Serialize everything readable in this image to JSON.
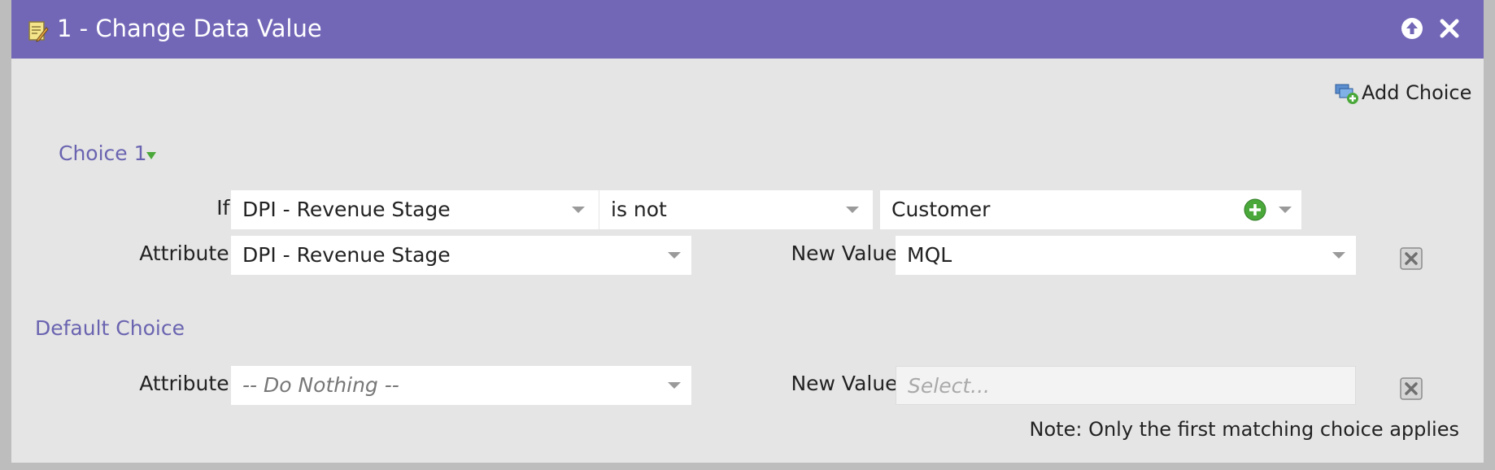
{
  "header": {
    "title": "1 - Change Data Value",
    "icons": [
      "edit-document-icon",
      "collapse-up-icon",
      "close-icon"
    ],
    "color": "#7267b7"
  },
  "toolbar": {
    "add_choice_label": "Add Choice",
    "add_choice_icon": "add-choice-icon"
  },
  "choice1": {
    "title": "Choice 1",
    "if_label": "If:",
    "condition_field": "DPI - Revenue Stage",
    "operator": "is not",
    "condition_value": "Customer",
    "attribute_label": "Attribute:",
    "attribute_value": "DPI - Revenue Stage",
    "new_value_label": "New Value:",
    "new_value": "MQL"
  },
  "default_choice": {
    "title": "Default Choice",
    "attribute_label": "Attribute:",
    "attribute_value": "-- Do Nothing --",
    "new_value_label": "New Value:",
    "new_value_placeholder": "Select..."
  },
  "note": "Note: Only the first matching choice applies"
}
